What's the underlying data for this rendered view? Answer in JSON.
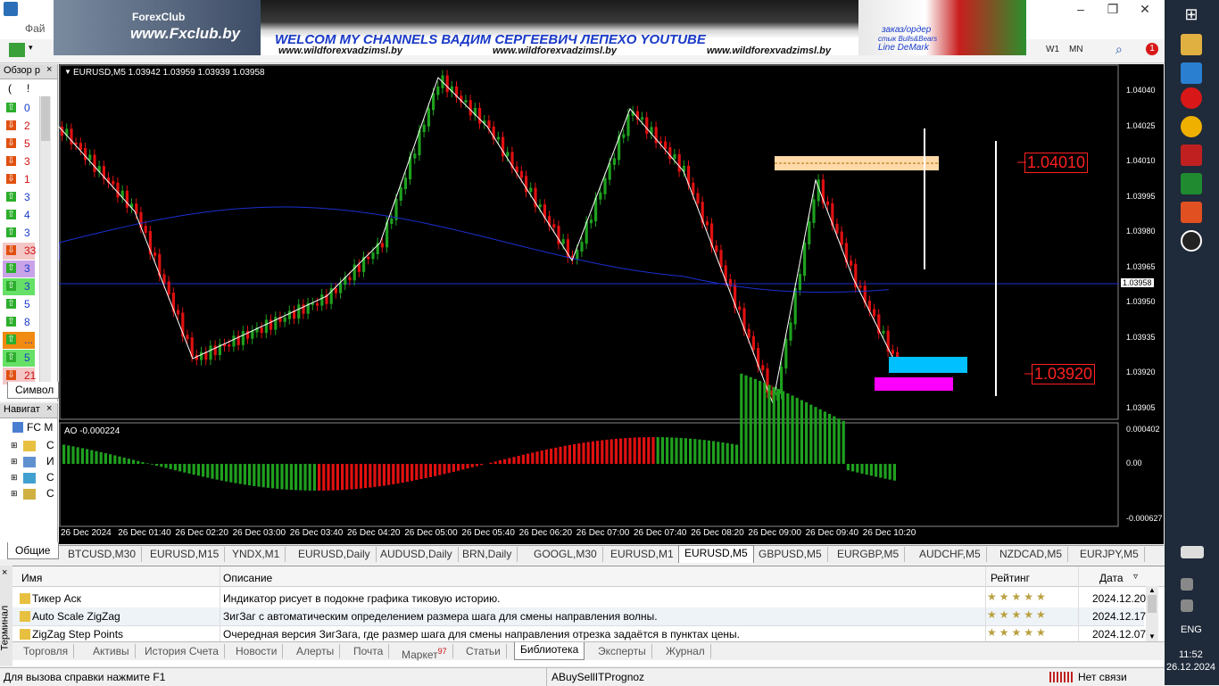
{
  "window": {
    "menu_file": "Фай"
  },
  "banner": {
    "site": "www.Fxclub.by",
    "logo": "ForexClub",
    "headline": "WELCOM MY CHANNELS ВАДИМ СЕРГЕЕВИЧ ЛЕПЕХО YOUTUBE",
    "link1": "www.wildforexvadzimsl.by",
    "link2": "www.wildforexvadzimsl.by",
    "link3": "www.wildforexvadzimsl.by",
    "order": "заказ/ордер",
    "bulls": "стык Bulls&Bears",
    "demark": "Line DeMark"
  },
  "toolbar": {
    "tf_w1": "W1",
    "tf_mn": "MN",
    "notif_count": "1"
  },
  "market_watch": {
    "title": "Обзор р",
    "col1": "(",
    "col2": "!",
    "rows": [
      {
        "dir": "up",
        "val": "0",
        "bg": ""
      },
      {
        "dir": "down",
        "val": "2",
        "bg": ""
      },
      {
        "dir": "down",
        "val": "5",
        "bg": ""
      },
      {
        "dir": "down",
        "val": "3",
        "bg": ""
      },
      {
        "dir": "down",
        "val": "1",
        "bg": ""
      },
      {
        "dir": "up",
        "val": "3",
        "bg": ""
      },
      {
        "dir": "up",
        "val": "4",
        "bg": ""
      },
      {
        "dir": "up",
        "val": "3",
        "bg": ""
      },
      {
        "dir": "down",
        "val": "33",
        "bg": "#f4c7c7"
      },
      {
        "dir": "up",
        "val": "3",
        "bg": "#c9a3e8"
      },
      {
        "dir": "up",
        "val": "3",
        "bg": "#66e066"
      },
      {
        "dir": "up",
        "val": "5",
        "bg": ""
      },
      {
        "dir": "up",
        "val": "8",
        "bg": ""
      },
      {
        "dir": "up",
        "val": "...",
        "bg": "#f08a10"
      },
      {
        "dir": "up",
        "val": "5",
        "bg": "#66e066"
      },
      {
        "dir": "down",
        "val": "21",
        "bg": "#f4c7c7"
      }
    ],
    "tab": "Символ"
  },
  "navigator": {
    "title": "Навигат",
    "root": "FC M",
    "items": [
      "С",
      "И",
      "С",
      "С"
    ],
    "tab": "Общие"
  },
  "chart": {
    "header": "EURUSD,M5  1.03942 1.03959 1.03939 1.03958",
    "price_labels": [
      "1.04040",
      "1.04025",
      "1.04010",
      "1.03995",
      "1.03980",
      "1.03965",
      "1.03950",
      "1.03935",
      "1.03920",
      "1.03905"
    ],
    "current_price": "1.03958",
    "level_high": "1.04010",
    "level_low": "1.03920",
    "ao_header": "AO -0.000224",
    "ao_labels": [
      "0.000402",
      "0.00",
      "-0.000627"
    ],
    "time_labels": [
      "26 Dec 2024",
      "26 Dec 01:40",
      "26 Dec 02:20",
      "26 Dec 03:00",
      "26 Dec 03:40",
      "26 Dec 04:20",
      "26 Dec 05:00",
      "26 Dec 05:40",
      "26 Dec 06:20",
      "26 Dec 07:00",
      "26 Dec 07:40",
      "26 Dec 08:20",
      "26 Dec 09:00",
      "26 Dec 09:40",
      "26 Dec 10:20"
    ],
    "colors": {
      "bull": "#1fa01f",
      "bear": "#e01010",
      "ma": "#1a2fd0",
      "zigzag": "#ffffff",
      "level_high_box": "#ffd9a8",
      "cyan": "#00c0ff",
      "magenta": "#ff00ff"
    }
  },
  "chart_tabs": [
    "BTCUSD,M30",
    "EURUSD,M15",
    "YNDX,M1",
    "EURUSD,Daily",
    "AUDUSD,Daily",
    "BRN,Daily",
    "GOOGL,M30",
    "EURUSD,M1",
    "EURUSD,M5",
    "GBPUSD,M5",
    "EURGBP,M5",
    "AUDCHF,M5",
    "NZDCAD,M5",
    "EURJPY,M5"
  ],
  "active_chart_tab": "EURUSD,M5",
  "terminal": {
    "side_label": "Терминал",
    "headers": {
      "name": "Имя",
      "desc": "Описание",
      "rating": "Рейтинг",
      "date": "Дата"
    },
    "rows": [
      {
        "name": "Тикер Аск",
        "desc": "Индикатор рисует в подокне графика тиковую историю.",
        "stars": "★★★★★",
        "date": "2024.12.20"
      },
      {
        "name": "Auto Scale ZigZag",
        "desc": "ЗигЗаг с автоматическим определением размера шага для смены направления волны.",
        "stars": "★★★★★",
        "date": "2024.12.17"
      },
      {
        "name": "ZigZag Step Points",
        "desc": "Очередная версия ЗигЗага, где размер шага для смены направления отрезка задаётся в пунктах цены.",
        "stars": "★★★★★",
        "date": "2024.12.07"
      }
    ],
    "tabs": [
      "Торговля",
      "Активы",
      "История Счета",
      "Новости",
      "Алерты",
      "Почта",
      "Маркет",
      "Статьи",
      "Библиотека",
      "Эксперты",
      "Журнал"
    ],
    "market_badge": "97",
    "active_tab": "Библиотека"
  },
  "status": {
    "help": "Для вызова справки нажмите F1",
    "profile": "ABuySellITPrognoz",
    "connection": "Нет связи"
  },
  "taskbar": {
    "lang": "ENG",
    "time": "11:52",
    "date": "26.12.2024"
  }
}
